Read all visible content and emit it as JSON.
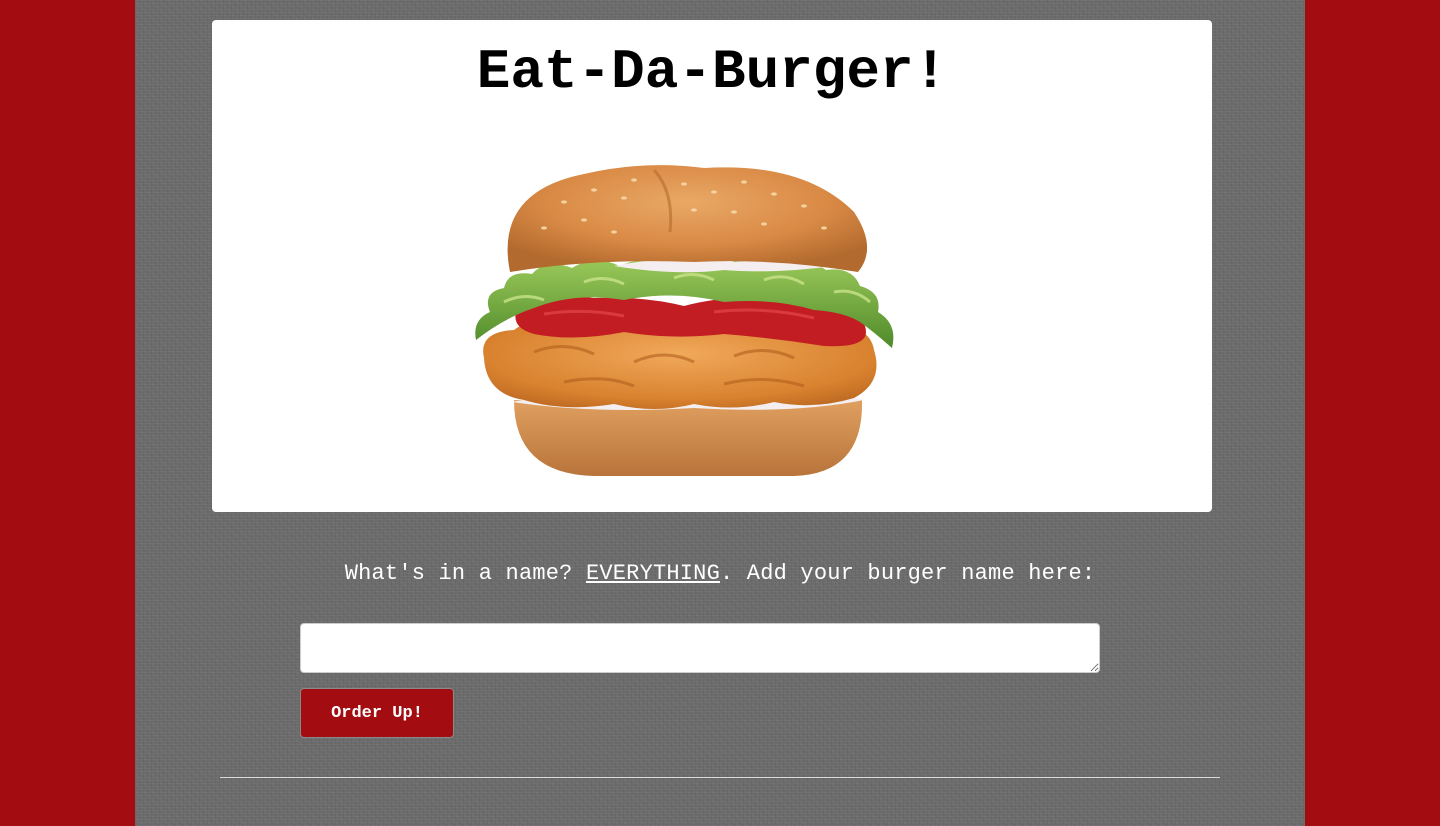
{
  "header": {
    "title": "Eat-Da-Burger!"
  },
  "hero_image": {
    "alt": "Crispy chicken burger"
  },
  "form": {
    "prompt_before": "What's in a name? ",
    "prompt_emphasis": "EVERYTHING",
    "prompt_after": ". Add your burger name here:",
    "input_value": "",
    "submit_label": "Order Up!"
  },
  "colors": {
    "accent": "#a30d11",
    "panel": "#6b6b6b",
    "jumbotron": "#ffffff"
  }
}
